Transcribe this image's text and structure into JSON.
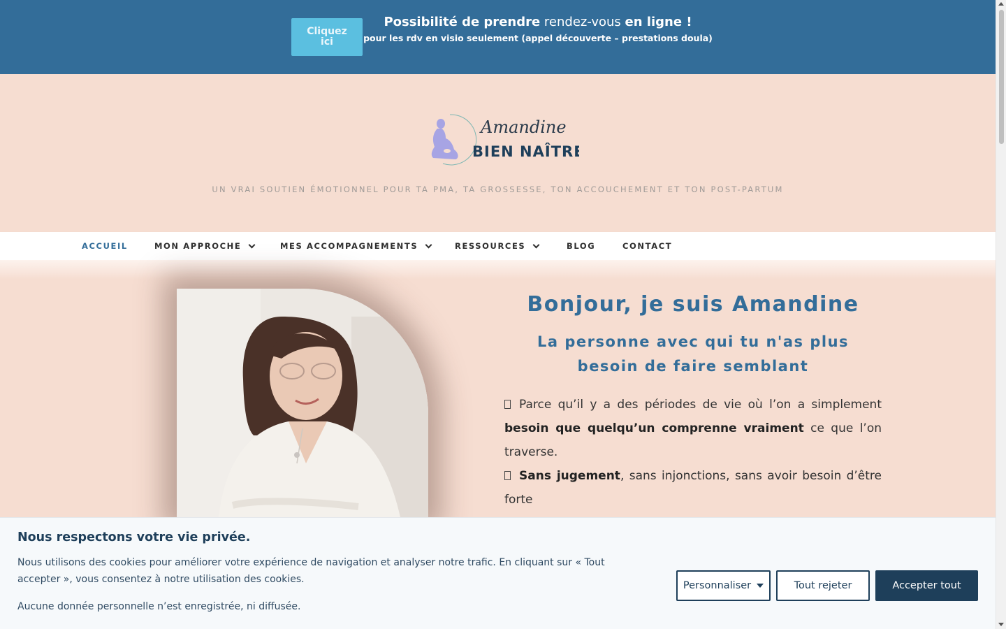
{
  "topbar": {
    "cta_label": "Cliquez ici",
    "headline_part1": "Possibilité de prendre",
    "headline_part2": " rendez-vous ",
    "headline_part3": "en ligne !",
    "subline": "pour les rdv en visio seulement (appel découverte – prestations doula)",
    "bg_color": "#336d99",
    "cta_color": "#5bbfe0"
  },
  "header": {
    "logo_script": "Amandine",
    "logo_name": "BIEN NAÎTRE",
    "tagline": "UN VRAI SOUTIEN ÉMOTIONNEL POUR TA PMA, TA GROSSESSE, TON ACCOUCHEMENT ET TON POST-PARTUM"
  },
  "nav": {
    "items": [
      {
        "label": "ACCUEIL",
        "active": true
      },
      {
        "label": "MON APPROCHE",
        "dropdown": true
      },
      {
        "label": "MES ACCOMPAGNEMENTS",
        "dropdown": true
      },
      {
        "label": "RESSOURCES",
        "dropdown": true
      },
      {
        "label": "BLOG"
      },
      {
        "label": "CONTACT"
      }
    ]
  },
  "hero": {
    "title": "Bonjour, je suis Amandine",
    "subtitle": "La personne avec qui tu n'as plus besoin de faire semblant",
    "p1_pre": "Parce qu’il y a des périodes de vie où l’on a simplement ",
    "p1_bold": "besoin que quelqu’un comprenne vraiment",
    "p1_post": " ce que l’on traverse.",
    "p2_bold": "Sans jugement",
    "p2_post": ", sans injonctions, sans avoir besoin d’être forte",
    "accent_color": "#336d99"
  },
  "cookie": {
    "title": "Nous respectons votre vie privée.",
    "text": "Nous utilisons des cookies pour améliorer votre expérience de navigation et analyser notre trafic. En cliquant sur « Tout accepter », vous consentez à notre utilisation des cookies.",
    "text2": "Aucune donnée personnelle n’est enregistrée, ni diffusée.",
    "customize_label": "Personnaliser",
    "reject_label": "Tout rejeter",
    "accept_label": "Accepter tout"
  }
}
